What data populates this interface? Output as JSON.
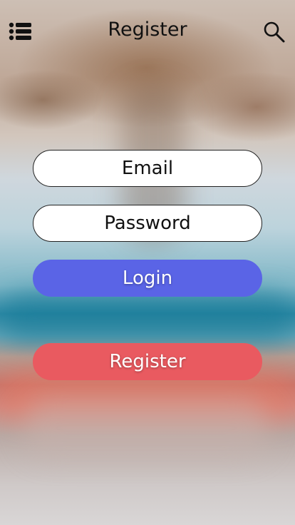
{
  "header": {
    "title": "Register",
    "menu_icon": "list-icon",
    "search_icon": "search-icon"
  },
  "form": {
    "email_placeholder": "Email",
    "password_placeholder": "Password",
    "login_label": "Login",
    "register_label": "Register"
  },
  "colors": {
    "login_button": "#5a64e6",
    "register_button": "#e95a60",
    "field_background": "#ffffff"
  }
}
